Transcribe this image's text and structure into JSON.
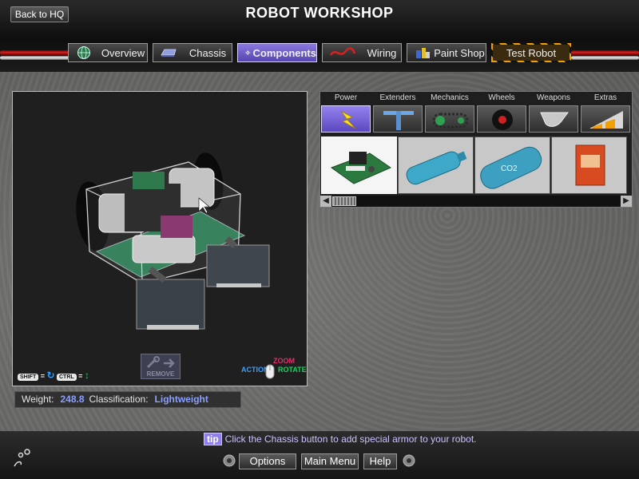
{
  "header": {
    "title": "ROBOT WORKSHOP",
    "back_label": "Back to HQ"
  },
  "nav": {
    "tabs": [
      {
        "label": "Overview",
        "icon": "globe-icon"
      },
      {
        "label": "Chassis",
        "icon": "chassis-icon"
      },
      {
        "label": "Components",
        "icon": "gear-icon",
        "active": true
      },
      {
        "label": "Wiring",
        "icon": "wire-icon"
      },
      {
        "label": "Paint Shop",
        "icon": "paint-cans-icon"
      },
      {
        "label": "Test Robot",
        "icon": "hazard-stripes"
      }
    ]
  },
  "viewport": {
    "shift_key": "SHIFT",
    "ctrl_key": "CTRL",
    "remove_label": "REMOVE",
    "action_label": "ACTION",
    "zoom_label": "ZOOM",
    "rotate_label": "ROTATE"
  },
  "stats": {
    "weight_label": "Weight:",
    "weight_value": "248.8",
    "class_label": "Classification:",
    "class_value": "Lightweight"
  },
  "parts": {
    "categories": [
      {
        "label": "Power",
        "icon": "lightning-icon",
        "active": true
      },
      {
        "label": "Extenders",
        "icon": "extender-icon"
      },
      {
        "label": "Mechanics",
        "icon": "chain-icon"
      },
      {
        "label": "Wheels",
        "icon": "wheel-icon"
      },
      {
        "label": "Weapons",
        "icon": "blade-icon"
      },
      {
        "label": "Extras",
        "icon": "wedge-icon"
      }
    ],
    "items": [
      {
        "name": "circuit-board",
        "text": ""
      },
      {
        "name": "battery-cylinder",
        "text": ""
      },
      {
        "name": "co2-tank",
        "text": "CO2"
      },
      {
        "name": "power-box",
        "text": ""
      }
    ]
  },
  "footer": {
    "tip_badge": "tip",
    "tip_text": "Click the Chassis button to add special armor to your robot.",
    "buttons": {
      "options": "Options",
      "main_menu": "Main Menu",
      "help": "Help"
    }
  },
  "colors": {
    "accent": "#6f5dd6",
    "value_text": "#8aa0ff",
    "cable_red": "#d82020"
  }
}
